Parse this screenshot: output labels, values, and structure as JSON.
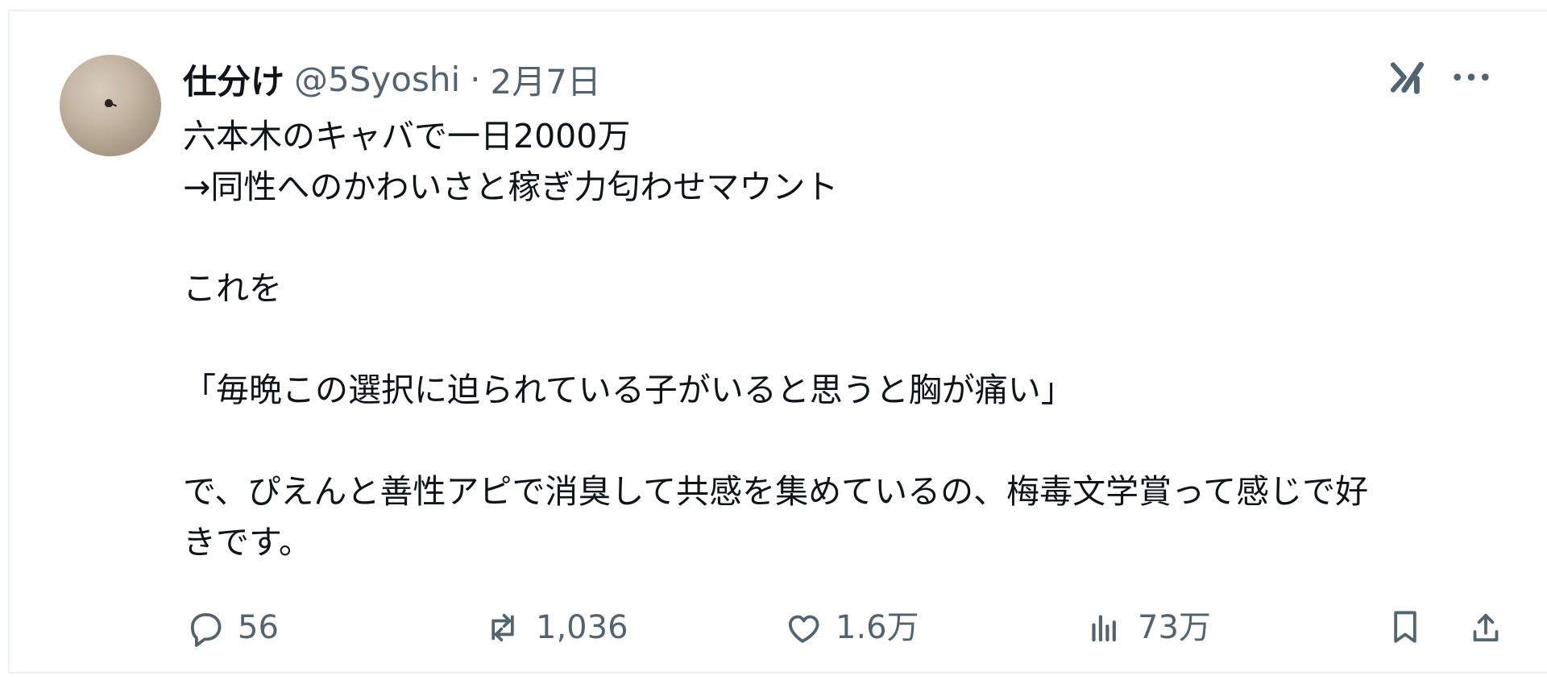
{
  "post": {
    "author": {
      "name": "仕分け",
      "handle": "@5Syoshi",
      "separator": "·",
      "date": "2月7日"
    },
    "content": {
      "lines": [
        "六本木のキャバで一日2000万",
        "→同性へのかわいさと稼ぎ力匂わせマウント",
        "",
        "これを",
        "",
        "「毎晩この選択に迫られている子がいると思うと胸が痛い」",
        "",
        "で、ぴえんと善性アピで消臭して共感を集めているの、梅毒文学賞って感じで好",
        "きです。"
      ]
    },
    "top_actions": {
      "grok_icon": "grok-icon",
      "more_icon": "more-options-icon"
    },
    "stats": {
      "replies": "56",
      "reposts": "1,036",
      "likes": "1.6万",
      "views": "73万"
    }
  },
  "colors": {
    "text_primary": "#0f1419",
    "text_secondary": "#536471",
    "border": "#eef1f3"
  },
  "icons": {
    "reply": "reply-icon",
    "repost": "repost-icon",
    "like": "like-icon",
    "views": "views-icon",
    "bookmark": "bookmark-icon",
    "share": "share-icon"
  }
}
